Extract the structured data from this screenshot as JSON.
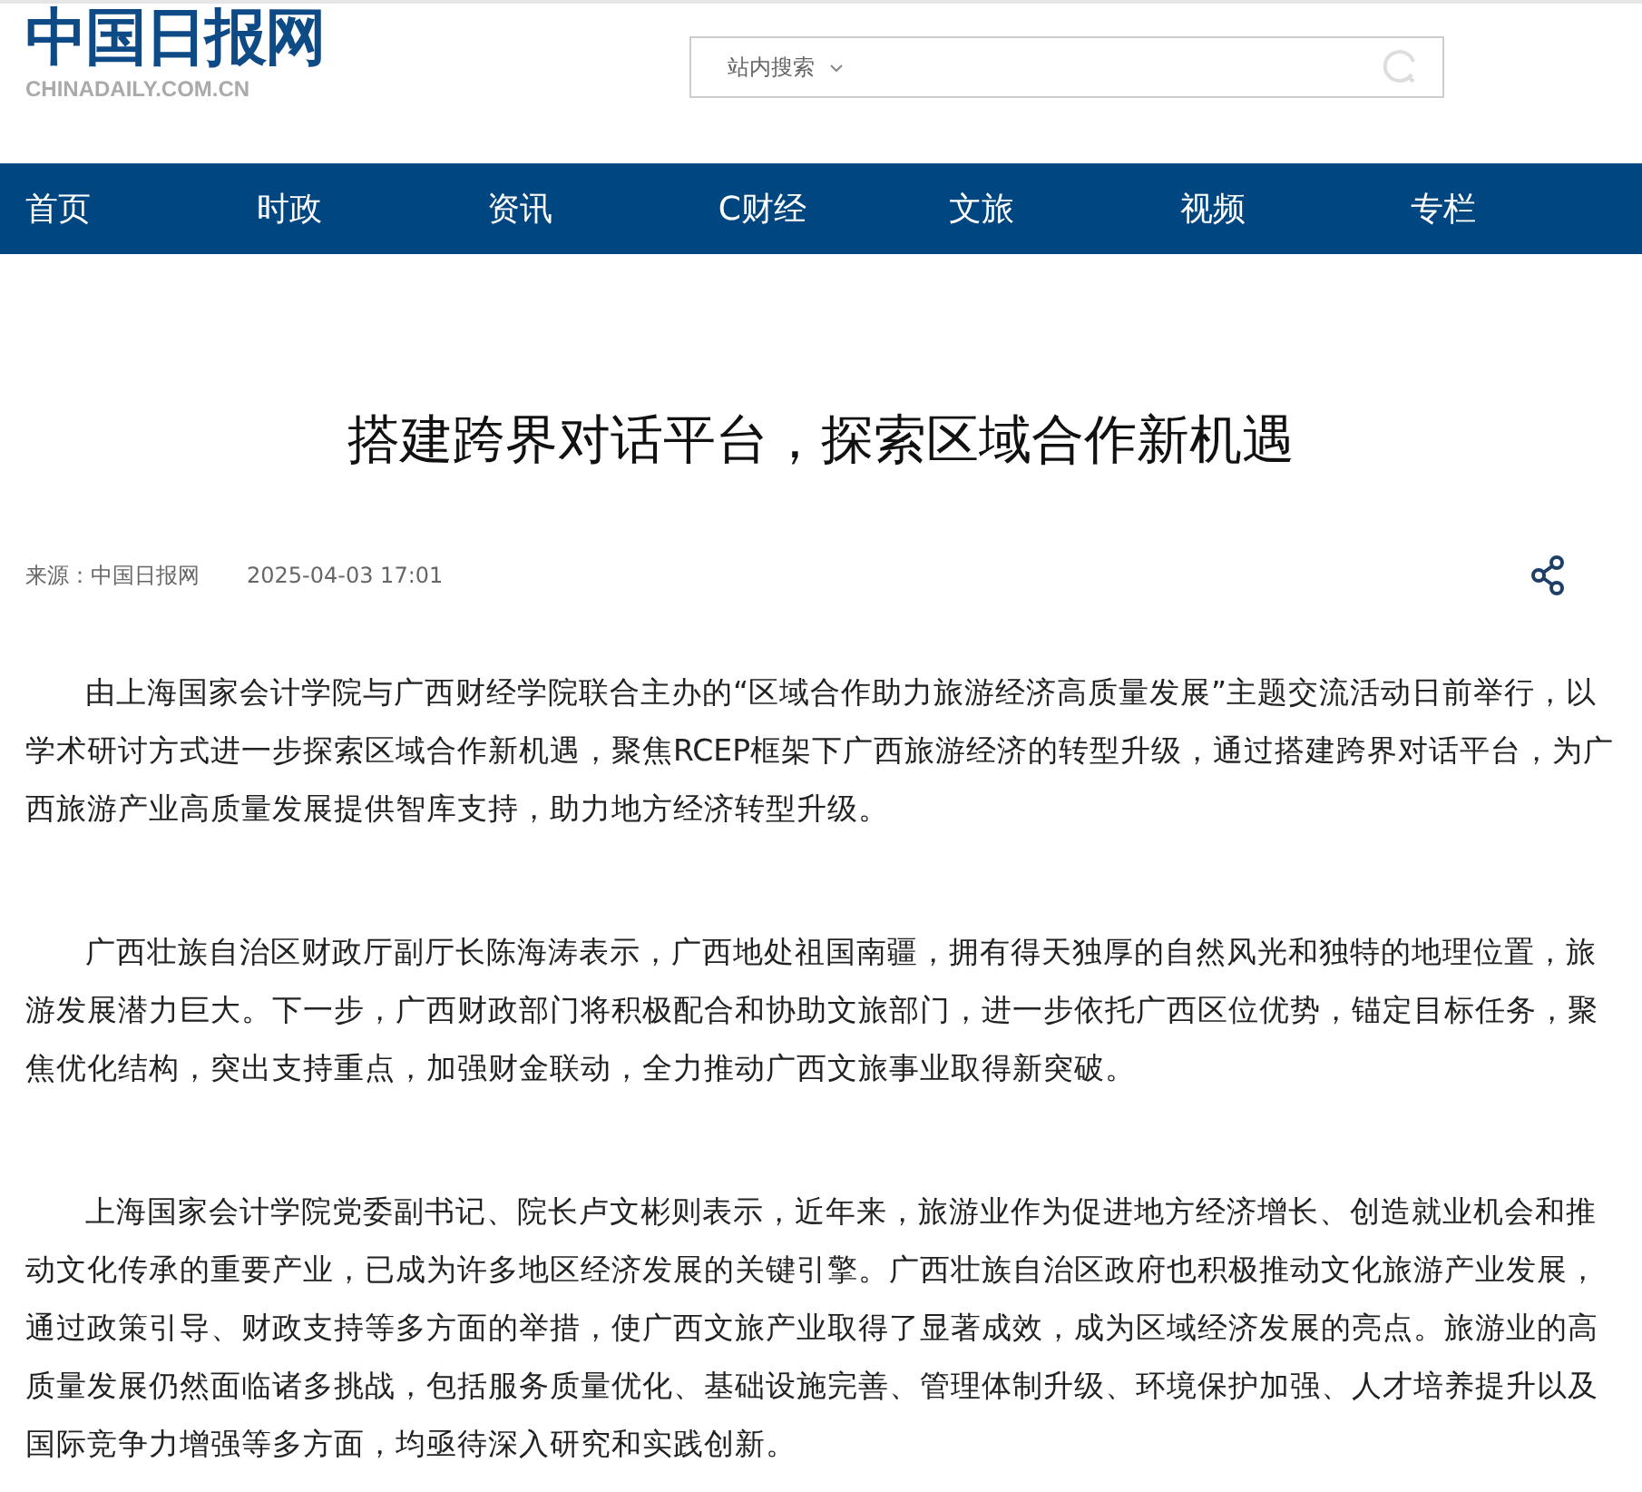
{
  "logo": {
    "name": "中国日报网",
    "domain": "CHINADAILY.COM.CN"
  },
  "search": {
    "scope": "站内搜索"
  },
  "nav": [
    {
      "label": "首页"
    },
    {
      "label": "时政"
    },
    {
      "label": "资讯"
    },
    {
      "label": "C财经"
    },
    {
      "label": "文旅"
    },
    {
      "label": "视频"
    },
    {
      "label": "专栏"
    }
  ],
  "article": {
    "title": "搭建跨界对话平台，探索区域合作新机遇",
    "source": "来源：中国日报网",
    "date": "2025-04-03 17:01",
    "paragraphs": [
      "由上海国家会计学院与广西财经学院联合主办的“区域合作助力旅游经济高质量发展”主题交流活动日前举行，以学术研讨方式进一步探索区域合作新机遇，聚焦RCEP框架下广西旅游经济的转型升级，通过搭建跨界对话平台，为广西旅游产业高质量发展提供智库支持，助力地方经济转型升级。",
      "广西壮族自治区财政厅副厅长陈海涛表示，广西地处祖国南疆，拥有得天独厚的自然风光和独特的地理位置，旅游发展潜力巨大。下一步，广西财政部门将积极配合和协助文旅部门，进一步依托广西区位优势，锚定目标任务，聚焦优化结构，突出支持重点，加强财金联动，全力推动广西文旅事业取得新突破。",
      "上海国家会计学院党委副书记、院长卢文彬则表示，近年来，旅游业作为促进地方经济增长、创造就业机会和推动文化传承的重要产业，已成为许多地区经济发展的关键引擎。广西壮族自治区政府也积极推动文化旅游产业发展，通过政策引导、财政支持等多方面的举措，使广西文旅产业取得了显著成效，成为区域经济发展的亮点。旅游业的高质量发展仍然面临诸多挑战，包括服务质量优化、基础设施完善、管理体制升级、环境保护加强、人才培养提升以及国际竞争力增强等多方面，均亟待深入研究和实践创新。"
    ]
  }
}
